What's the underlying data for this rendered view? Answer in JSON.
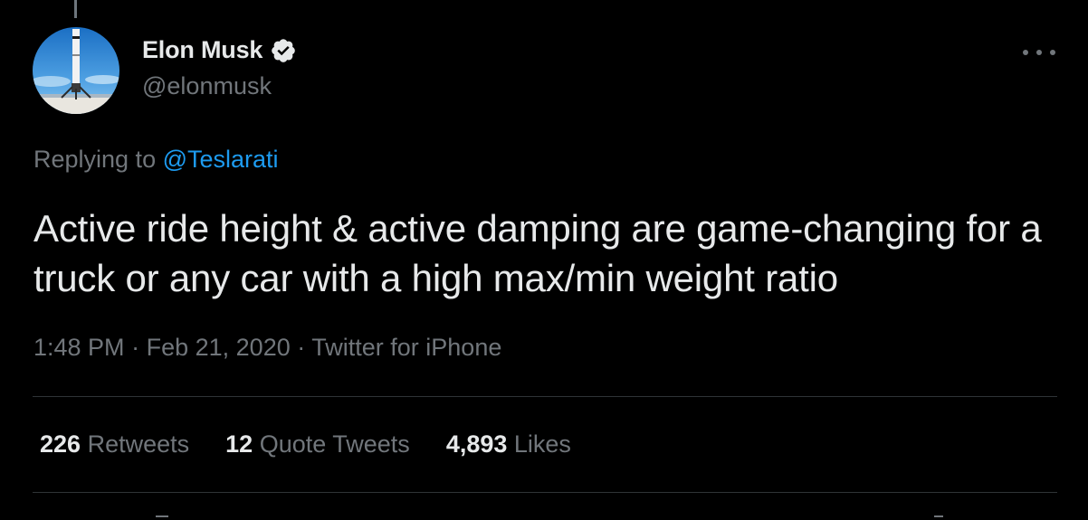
{
  "author": {
    "display_name": "Elon Musk",
    "handle": "@elonmusk",
    "verified": true,
    "avatar_icon": "rocket-landing-avatar"
  },
  "reply": {
    "prefix": "Replying to",
    "mention": "@Teslarati"
  },
  "tweet": {
    "text": "Active ride height & active damping are game-changing for a truck or any car with a high max/min weight ratio"
  },
  "meta": {
    "time": "1:48 PM",
    "separator": "·",
    "date": "Feb 21, 2020",
    "source": "Twitter for iPhone"
  },
  "stats": [
    {
      "count": "226",
      "label": "Retweets"
    },
    {
      "count": "12",
      "label": "Quote Tweets"
    },
    {
      "count": "4,893",
      "label": "Likes"
    }
  ],
  "colors": {
    "background": "#000000",
    "primary_text": "#e7e9ea",
    "secondary_text": "#71767b",
    "link": "#1d9bf0",
    "divider": "#2f3336"
  },
  "icons": {
    "verified": "verified-badge-icon",
    "more": "more-options-icon"
  }
}
